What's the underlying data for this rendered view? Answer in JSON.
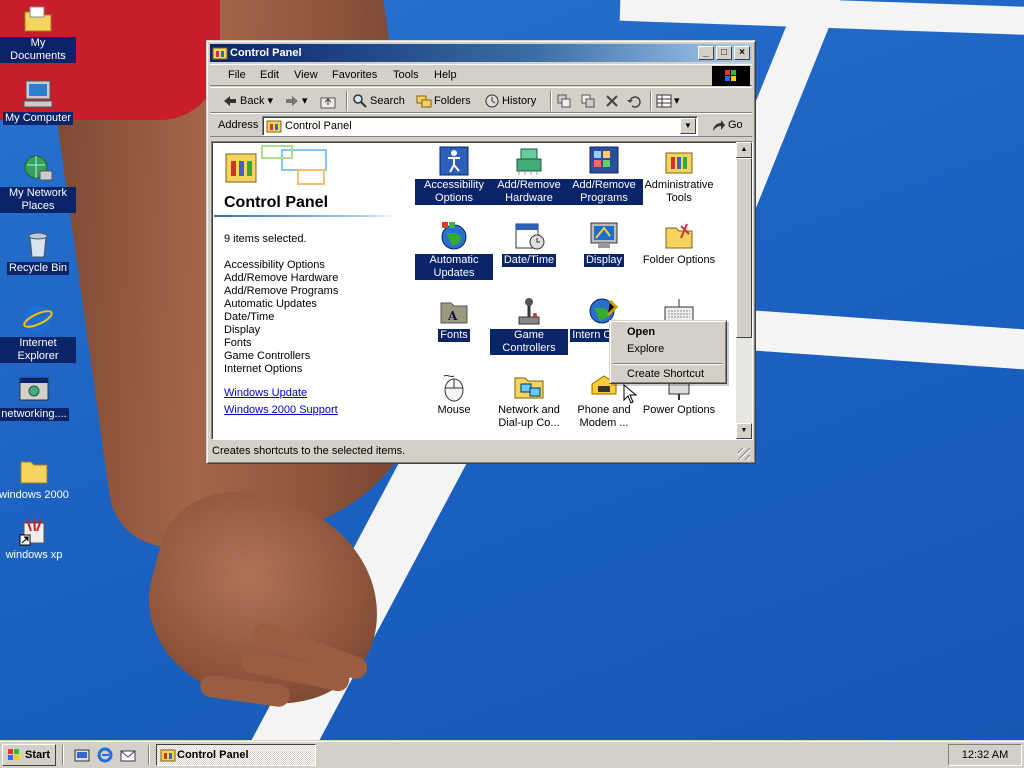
{
  "desktop": {
    "icons": [
      {
        "label": "My Documents"
      },
      {
        "label": "My Computer"
      },
      {
        "label": "My Network Places"
      },
      {
        "label": "Recycle Bin"
      },
      {
        "label": "Internet Explorer"
      },
      {
        "label": "networking...."
      },
      {
        "label": "windows 2000"
      },
      {
        "label": "windows xp"
      }
    ]
  },
  "window": {
    "title": "Control Panel",
    "controls": {
      "minimize": "_",
      "maximize": "□",
      "close": "×"
    },
    "menu": [
      "File",
      "Edit",
      "View",
      "Favorites",
      "Tools",
      "Help"
    ],
    "toolbar": {
      "back": "Back",
      "search": "Search",
      "folders": "Folders",
      "history": "History"
    },
    "address": {
      "label": "Address",
      "value": "Control Panel",
      "go": "Go"
    },
    "left_pane": {
      "title": "Control Panel",
      "count": "9 items selected.",
      "selected": [
        "Accessibility Options",
        "Add/Remove Hardware",
        "Add/Remove Programs",
        "Automatic Updates",
        "Date/Time",
        "Display",
        "Fonts",
        "Game Controllers",
        "Internet Options"
      ],
      "links": [
        "Windows Update",
        "Windows 2000 Support"
      ]
    },
    "items": [
      {
        "label": "Accessibility Options",
        "selected": true
      },
      {
        "label": "Add/Remove Hardware",
        "selected": true
      },
      {
        "label": "Add/Remove Programs",
        "selected": true
      },
      {
        "label": "Administrative Tools",
        "selected": false
      },
      {
        "label": "Automatic Updates",
        "selected": true
      },
      {
        "label": "Date/Time",
        "selected": true
      },
      {
        "label": "Display",
        "selected": true
      },
      {
        "label": "Folder Options",
        "selected": false
      },
      {
        "label": "Fonts",
        "selected": true
      },
      {
        "label": "Game Controllers",
        "selected": true
      },
      {
        "label": "Intern Option",
        "selected": true
      },
      {
        "label": "",
        "selected": false
      },
      {
        "label": "Mouse",
        "selected": false
      },
      {
        "label": "Network and Dial-up Co...",
        "selected": false
      },
      {
        "label": "Phone and Modem ...",
        "selected": false
      },
      {
        "label": "Power Options",
        "selected": false
      }
    ],
    "status": "Creates shortcuts to the selected items."
  },
  "context_menu": {
    "items": [
      "Open",
      "Explore",
      "Create Shortcut"
    ]
  },
  "taskbar": {
    "start": "Start",
    "task": "Control Panel",
    "clock": "12:32 AM"
  },
  "colors": {
    "selection": "#0a246a",
    "face": "#d4d0c8",
    "desktop": "#1f66c4",
    "link": "#0000cc"
  }
}
